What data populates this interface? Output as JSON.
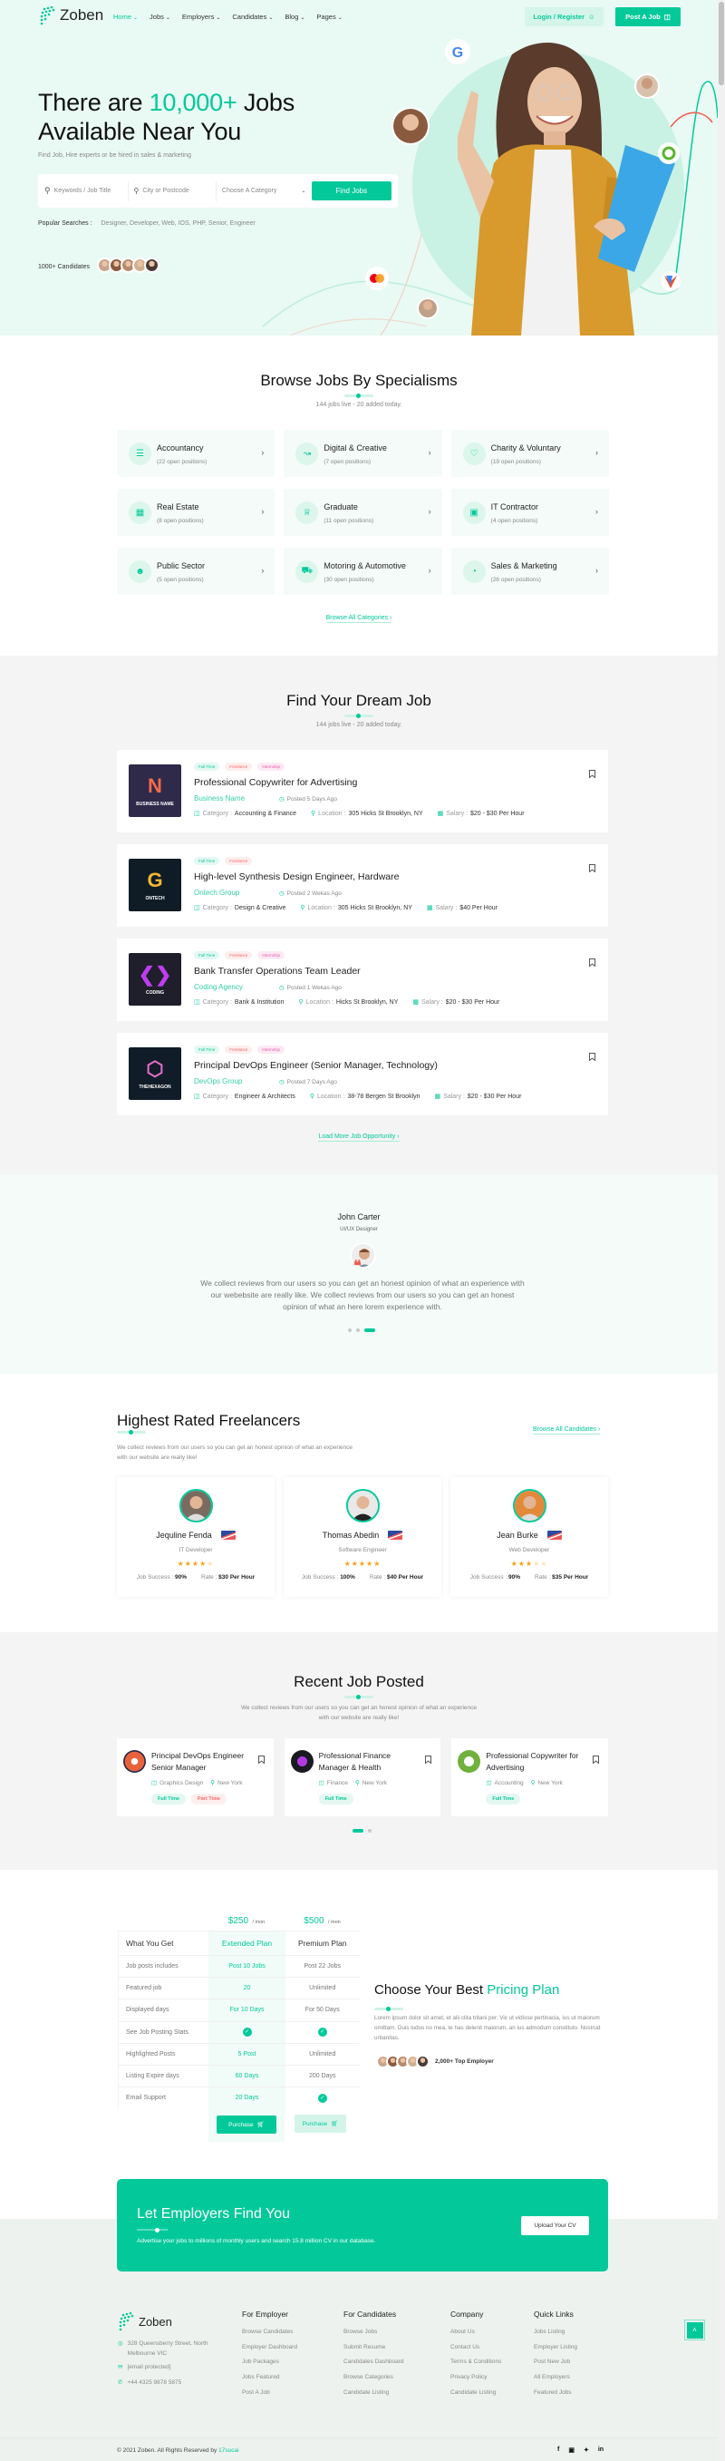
{
  "colors": {
    "accent": "#03c99a",
    "hero_bg": "#e9f9f4",
    "light_section": "#f4f4f4"
  },
  "header": {
    "logo": "Zoben",
    "nav": [
      {
        "label": "Home",
        "active": true
      },
      {
        "label": "Jobs"
      },
      {
        "label": "Employers"
      },
      {
        "label": "Candidates"
      },
      {
        "label": "Blog"
      },
      {
        "label": "Pages"
      }
    ],
    "login_label": "Login / Register",
    "post_job_label": "Post A Job"
  },
  "hero": {
    "title_pre": "There are ",
    "title_highlight": "10,000+",
    "title_post": " Jobs",
    "title_line2": "Available Near You",
    "subtitle": "Find Job, Hire experts or be hired in sales & marketing",
    "search": {
      "keyword_placeholder": "Keywords / Job Title",
      "city_placeholder": "City or Postcode",
      "category_placeholder": "Choose A Category",
      "button": "Find Jobs"
    },
    "popular_label": "Popular Searches :",
    "popular_terms": "Designer, Developer, Web, IOS, PHP, Senior, Engineer",
    "candidates_label": "1000+ Candidates",
    "brand_badges": [
      "google-icon",
      "mastercard-icon",
      "brand-icon"
    ]
  },
  "specialisms": {
    "title": "Browse Jobs By Specialisms",
    "subtitle": "144 jobs live - 20 added today.",
    "items": [
      {
        "name": "Accountancy",
        "count": "(22 open positions)",
        "icon": "layers-icon"
      },
      {
        "name": "Digital & Creative",
        "count": "(7 open positions)",
        "icon": "chart-icon"
      },
      {
        "name": "Charity & Voluntary",
        "count": "(19 open positions)",
        "icon": "heart-icon"
      },
      {
        "name": "Real Estate",
        "count": "(8 open positions)",
        "icon": "building-icon"
      },
      {
        "name": "Graduate",
        "count": "(11 open positions)",
        "icon": "crown-icon"
      },
      {
        "name": "IT Contractor",
        "count": "(4 open positions)",
        "icon": "monitor-icon"
      },
      {
        "name": "Public Sector",
        "count": "(5 open positions)",
        "icon": "people-icon"
      },
      {
        "name": "Motoring & Automotive",
        "count": "(30 open positions)",
        "icon": "truck-icon"
      },
      {
        "name": "Sales & Marketing",
        "count": "(26 open positions)",
        "icon": "pie-icon"
      }
    ],
    "browse_all": "Browse All Categories"
  },
  "jobs": {
    "title": "Find Your Dream Job",
    "subtitle": "144 jobs live - 20 added today.",
    "category_label": "Category :",
    "location_label": "Location :",
    "salary_label": "Salary :",
    "items": [
      {
        "tags": [
          "Full Time",
          "Freelance",
          "Internship"
        ],
        "title": "Professional Copywriter for Advertising",
        "company": "Business Name",
        "posted": "Posted 5 Days Ago",
        "category": "Accounting & Finance",
        "location": "305 Hicks St Brooklyn, NY",
        "salary": "$20 - $30 Per Hour",
        "logo_text": "BUSINESS NAME",
        "logo_letter": "N"
      },
      {
        "tags": [
          "Full Time",
          "Freelance"
        ],
        "title": "High-level Synthesis Design Engineer, Hardware",
        "company": "Ontech Group",
        "posted": "Posted 2 Wekas Ago",
        "category": "Design & Creative",
        "location": "305 Hicks St Brooklyn, NY",
        "salary": "$40 Per Hour",
        "logo_text": "ONTECH",
        "logo_letter": "G"
      },
      {
        "tags": [
          "Full Time",
          "Freelance",
          "Internship"
        ],
        "title": "Bank Transfer Operations Team Leader",
        "company": "Coding Agency",
        "posted": "Posted 1 Wekas Ago",
        "category": "Bank & Institution",
        "location": "Hicks St Brooklyn, NY",
        "salary": "$20 - $30 Per Hour",
        "logo_text": "CODING",
        "logo_letter": "❮❯"
      },
      {
        "tags": [
          "Full Time",
          "Freelance",
          "Internship"
        ],
        "title": "Principal DevOps Engineer (Senior Manager, Technology)",
        "company": "DevOps Group",
        "posted": "Posted 7 Days Ago",
        "category": "Engineer & Architects",
        "location": "38-78 Bergen St Brooklyn",
        "salary": "$20 - $30 Per Hour",
        "logo_text": "THEHEXAGON",
        "logo_letter": "⬡"
      }
    ],
    "load_more": "Load More Job Opportunity"
  },
  "testimonial": {
    "name": "John Carter",
    "role": "UI/UX Designer",
    "quote": "We collect reviews from our users so you can get an honest opinion of what an experience with our webebsite are really like. We collect reviews from our users so you can get an honest opinion of what an here lorem experience with.",
    "slides": 3,
    "active_slide": 3
  },
  "freelancers": {
    "title": "Highest Rated Freelancers",
    "description": "We collect reviews from our users so you can get an honest opinion of what an experience with our website are really like!",
    "browse_all": "Browse All Candidates",
    "job_success_label": "Job Success :",
    "rate_label": "Rate :",
    "items": [
      {
        "name": "Jequline Fenda",
        "role": "IT Developer",
        "rating": 4,
        "job_success": "90%",
        "rate": "$30 Per Hour"
      },
      {
        "name": "Thomas Abedin",
        "role": "Software Engineer",
        "rating": 5,
        "job_success": "100%",
        "rate": "$40 Per Hour"
      },
      {
        "name": "Jean Burke",
        "role": "Web Developer",
        "rating": 3,
        "job_success": "90%",
        "rate": "$35 Per Hour"
      }
    ]
  },
  "recent": {
    "title": "Recent Job Posted",
    "description": "We collect reviews from our users so you can get an honest opinion of what an experience with our website are really like!",
    "items": [
      {
        "title": "Principal DevOps Engineer Senior Manager",
        "category": "Graphics Design",
        "location": "New York",
        "tags": [
          "Full Time",
          "Part Time"
        ]
      },
      {
        "title": "Professional Finance Manager & Health",
        "category": "Finance",
        "location": "New York",
        "tags": [
          "Full Time"
        ]
      },
      {
        "title": "Professional Copywriter for Advertising",
        "category": "Accounting",
        "location": "New York",
        "tags": [
          "Full Time"
        ]
      }
    ],
    "slides": 2,
    "active_slide": 1
  },
  "pricing": {
    "plans": [
      {
        "price": "$250",
        "period": "/ mon",
        "name": "Extended Plan",
        "button": "Purchase"
      },
      {
        "price": "$500",
        "period": "/ mon",
        "name": "Premium Plan",
        "button": "Purchase"
      }
    ],
    "header_label": "What You Get",
    "rows": [
      {
        "label": "Job posts includes",
        "values": [
          "Post 10 Jobs",
          "Post 22 Jobs"
        ]
      },
      {
        "label": "Featured job",
        "values": [
          "20",
          "Unlimited"
        ]
      },
      {
        "label": "Displayed days",
        "values": [
          "For 10 Days",
          "For 50 Days"
        ]
      },
      {
        "label": "See Job Posting Stats",
        "values": [
          "check",
          "check"
        ]
      },
      {
        "label": "Highlighted Posts",
        "values": [
          "5 Post",
          "Unlimited"
        ]
      },
      {
        "label": "Listing Expire days",
        "values": [
          "60 Days",
          "200 Days"
        ]
      },
      {
        "label": "Email Support",
        "values": [
          "20 Days",
          "check"
        ]
      }
    ],
    "title_pre": "Choose Your Best ",
    "title_highlight": "Pricing Plan",
    "description": "Lorem ipsum dolor sit amet, et alii clita tritani per. Vix ut vidisse pertinacia, ius ut maiorum omittam. Duis ludus no mea, te has delenit maiorum, an ius admodum constituto. Nostrud urbanitas.",
    "employers_label": "2,000+ Top Employer"
  },
  "cta": {
    "title": "Let Employers Find You",
    "description": "Advertise your jobs to millions of monthly users and search 15.8 million CV in our database.",
    "button": "Upload Your CV"
  },
  "footer": {
    "logo": "Zoben",
    "address": "328 Queensberry Street, North Melbourne VIC",
    "email": "[email protected]",
    "phone": "+44 4325 9878 5875",
    "columns": [
      {
        "title": "For Employer",
        "links": [
          "Browse Candidates",
          "Employer Dashboard",
          "Job Packages",
          "Jobs Featured",
          "Post A Job"
        ]
      },
      {
        "title": "For Candidates",
        "links": [
          "Browse Jobs",
          "Submit Resume",
          "Candidates Dashboard",
          "Browse Categories",
          "Candidate Listing"
        ]
      },
      {
        "title": "Company",
        "links": [
          "About Us",
          "Contact Us",
          "Terms & Conditions",
          "Privacy Policy",
          "Candidate Listing"
        ]
      },
      {
        "title": "Quick Links",
        "links": [
          "Jobs Listing",
          "Employer Listing",
          "Post New Job",
          "All Employers",
          "Featured Jobs"
        ]
      }
    ],
    "copyright_pre": "© 2021 Zoben. All Rights Reserved by ",
    "copyright_link": "17sucai",
    "social": [
      "facebook-icon",
      "instagram-icon",
      "twitter-icon",
      "linkedin-icon"
    ]
  }
}
